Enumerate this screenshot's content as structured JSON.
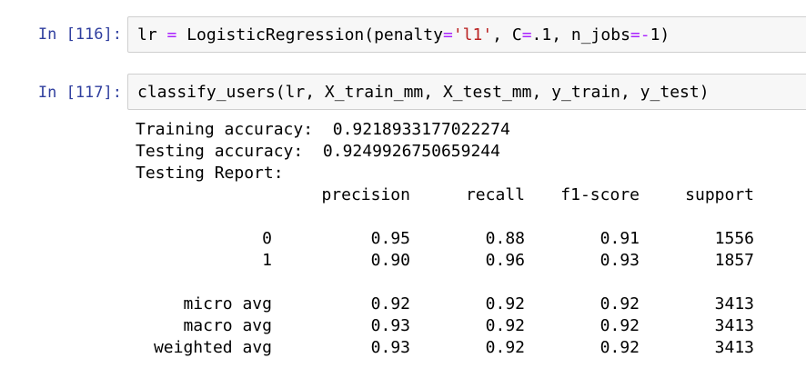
{
  "cells": [
    {
      "prompt": "In [116]:",
      "code": {
        "t1": "lr ",
        "op1": "=",
        "t2": " LogisticRegression(penalty",
        "op2": "=",
        "str1": "'l1'",
        "t3": ", C",
        "op3": "=",
        "t4": ".1, n_jobs",
        "op4": "=-",
        "t5": "1)"
      }
    },
    {
      "prompt": "In [117]:",
      "code": "classify_users(lr, X_train_mm, X_test_mm, y_train, y_test)"
    }
  ],
  "output": {
    "training_accuracy": "Training accuracy:  0.9218933177022274",
    "testing_accuracy": "Testing accuracy:  0.9249926750659244",
    "report_title": "Testing Report:",
    "headers": [
      "",
      "precision",
      "recall",
      "f1-score",
      "support"
    ],
    "rows": [
      [
        "0",
        "0.95",
        "0.88",
        "0.91",
        "1556"
      ],
      [
        "1",
        "0.90",
        "0.96",
        "0.93",
        "1857"
      ],
      [
        "micro avg",
        "0.92",
        "0.92",
        "0.92",
        "3413"
      ],
      [
        "macro avg",
        "0.93",
        "0.92",
        "0.92",
        "3413"
      ],
      [
        "weighted avg",
        "0.93",
        "0.92",
        "0.92",
        "3413"
      ]
    ]
  },
  "colors": {
    "prompt": "#303f9f",
    "operator": "#aa22ff",
    "string": "#ba2121",
    "cell_background": "#f7f7f7",
    "cell_border": "#cfcfcf"
  }
}
